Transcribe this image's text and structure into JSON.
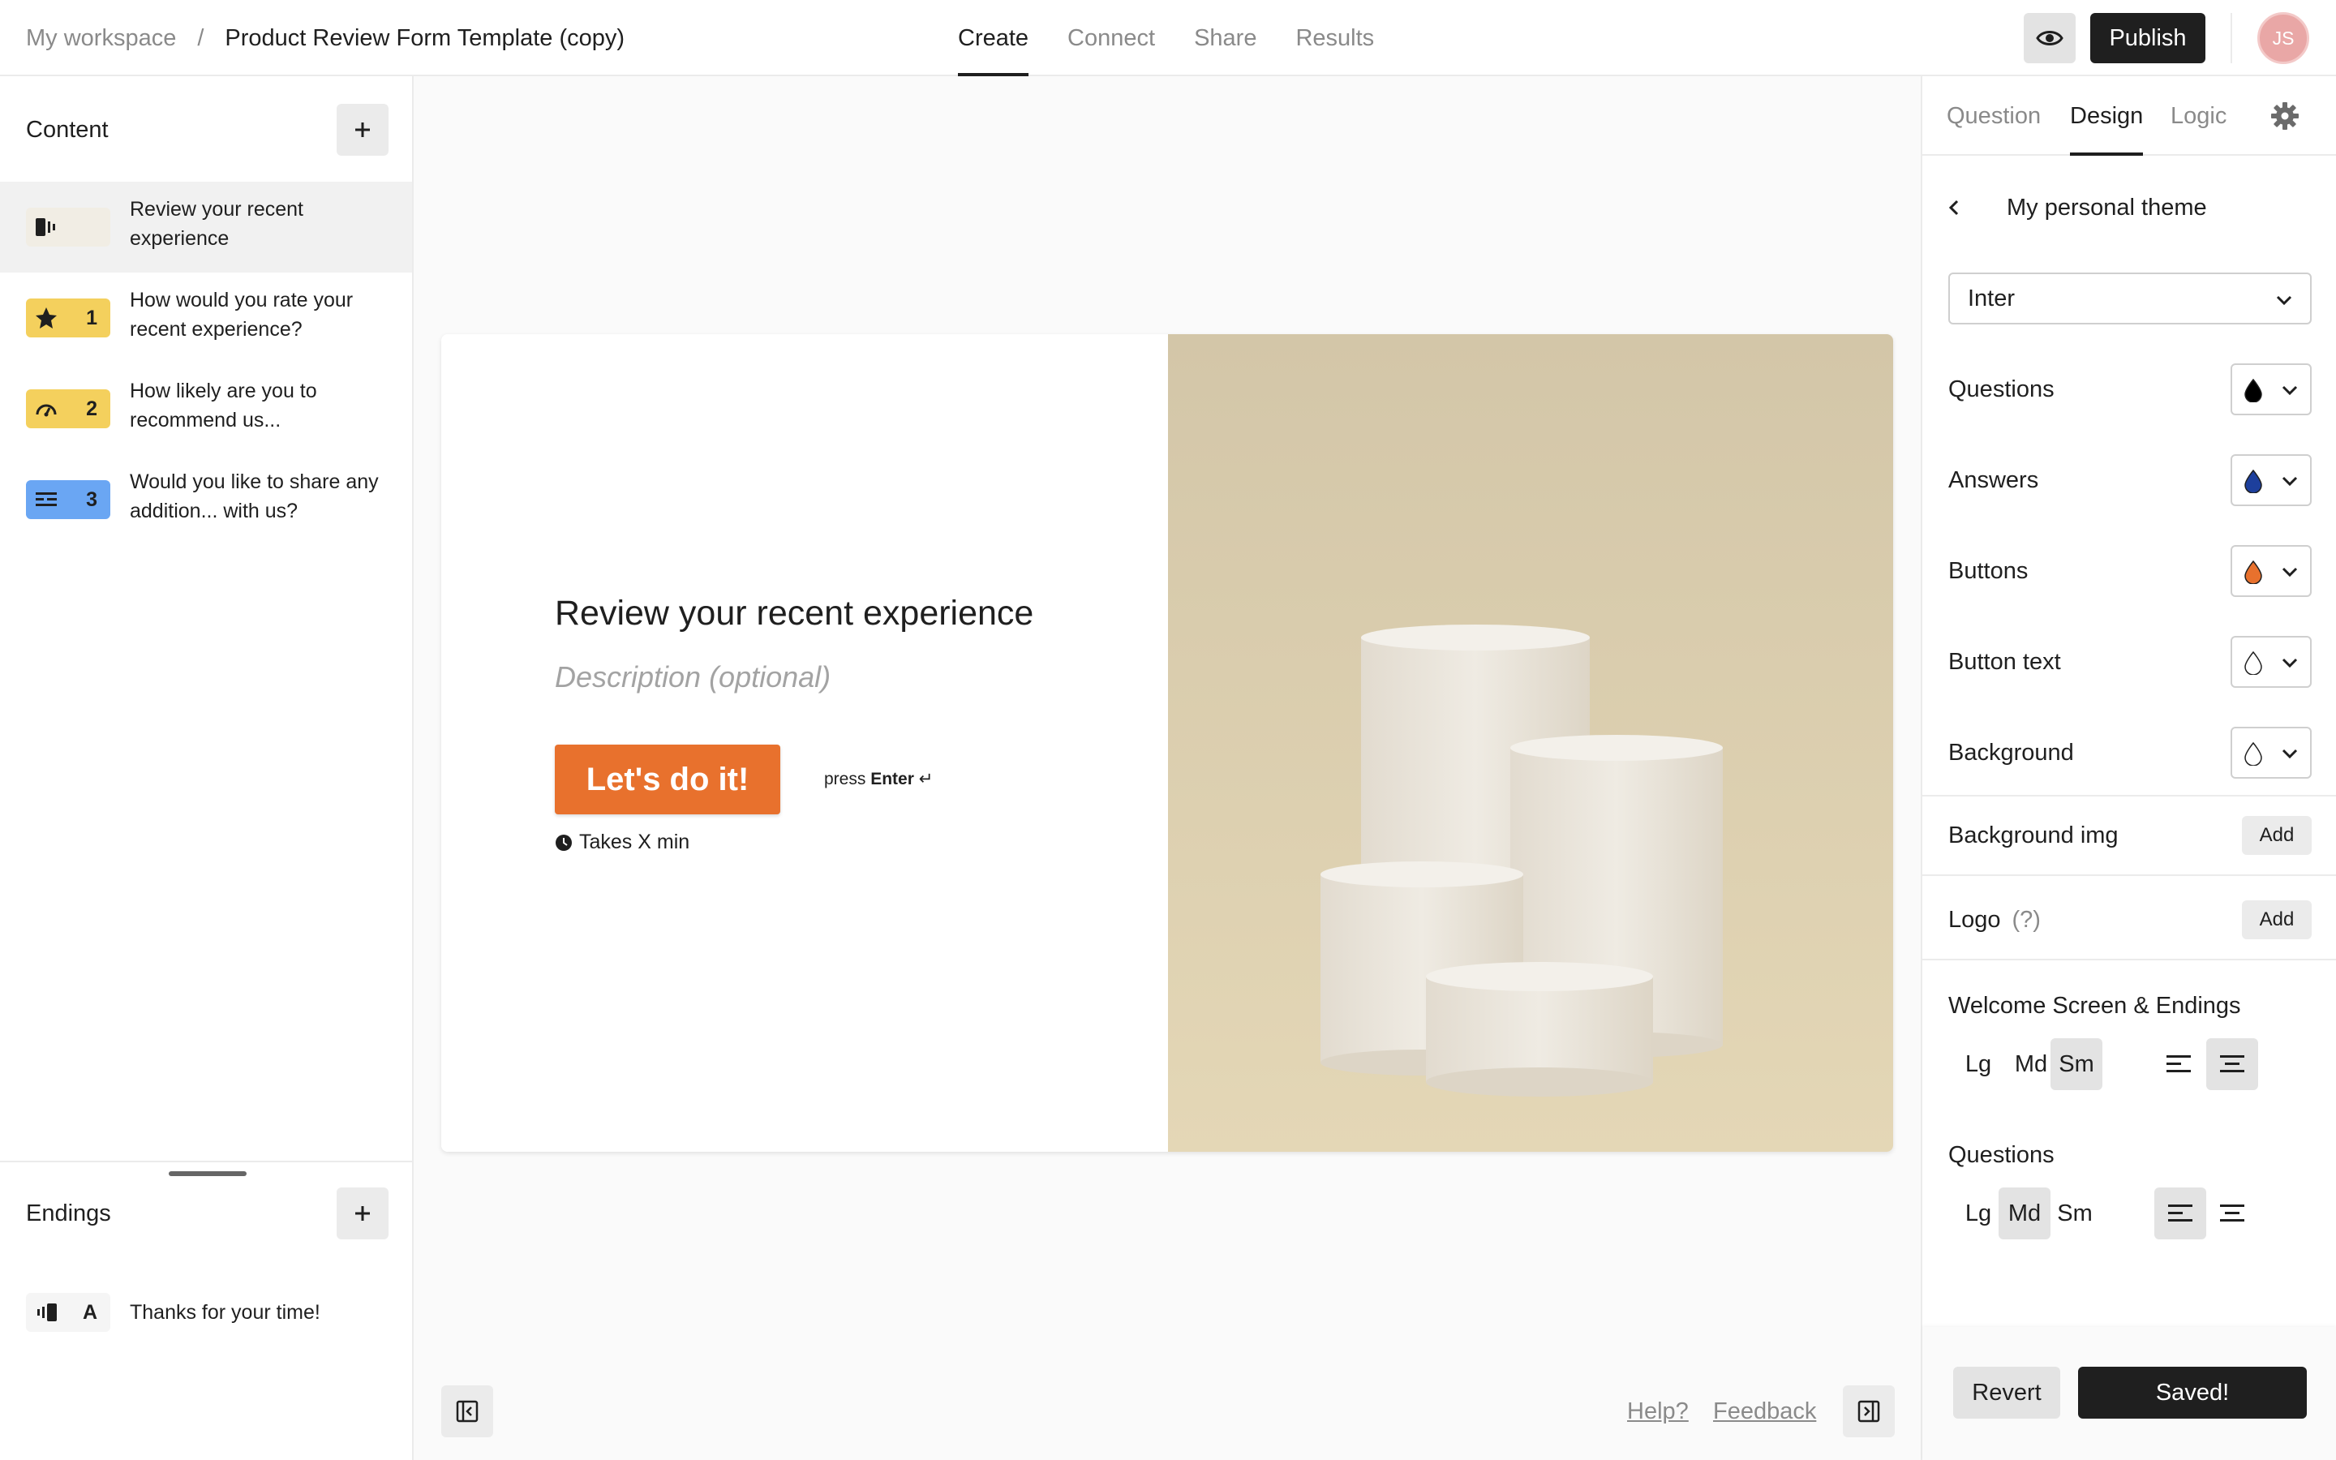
{
  "topbar": {
    "workspace": "My workspace",
    "separator": "/",
    "form_title": "Product Review Form Template (copy)",
    "tabs": [
      {
        "label": "Create",
        "active": true
      },
      {
        "label": "Connect",
        "active": false
      },
      {
        "label": "Share",
        "active": false
      },
      {
        "label": "Results",
        "active": false
      }
    ],
    "preview_icon": "eye-icon",
    "publish_label": "Publish",
    "avatar_initials": "JS"
  },
  "sidebar": {
    "content_title": "Content",
    "add_icon": "plus-icon",
    "items": [
      {
        "icon": "welcome-screen-icon",
        "number": "",
        "label": "Review your recent experience",
        "color": "#f1ede4",
        "selected": true
      },
      {
        "icon": "star-icon",
        "number": "1",
        "label": "How would you rate your recent experience?",
        "color": "#f4d05d",
        "selected": false
      },
      {
        "icon": "gauge-icon",
        "number": "2",
        "label": "How likely are you to recommend us...",
        "color": "#f4d05d",
        "selected": false
      },
      {
        "icon": "long-text-icon",
        "number": "3",
        "label": "Would you like to share any addition... with us?",
        "color": "#6aa6f3",
        "selected": false
      }
    ],
    "endings_title": "Endings",
    "endings": [
      {
        "icon": "ending-screen-icon",
        "letter": "A",
        "label": "Thanks for your time!",
        "color": "#f5f5f5"
      }
    ]
  },
  "canvas": {
    "welcome_title": "Review your recent experience",
    "description_placeholder": "Description (optional)",
    "button_label": "Let's do it!",
    "press_text": "press",
    "enter_text": "Enter",
    "enter_symbol": "↵",
    "time_text": "Takes X min",
    "button_color": "#e8712d",
    "image_background": "#d8c9aa",
    "help_label": "Help?",
    "feedback_label": "Feedback"
  },
  "design_panel": {
    "tabs": [
      {
        "label": "Question",
        "active": false
      },
      {
        "label": "Design",
        "active": true
      },
      {
        "label": "Logic",
        "active": false
      }
    ],
    "settings_icon": "gear-icon",
    "theme_name": "My personal theme",
    "font": "Inter",
    "colors": [
      {
        "label": "Questions",
        "color": "#000000"
      },
      {
        "label": "Answers",
        "color": "#1d3f9c"
      },
      {
        "label": "Buttons",
        "color": "#e8712d"
      },
      {
        "label": "Button text",
        "color": "#ffffff"
      },
      {
        "label": "Background",
        "color": "#ffffff"
      }
    ],
    "background_img_label": "Background img",
    "background_img_action": "Add",
    "logo_label": "Logo",
    "logo_hint": "(?)",
    "logo_action": "Add",
    "welcome_size_label": "Welcome Screen & Endings",
    "welcome_sizes": [
      {
        "label": "Lg",
        "active": false
      },
      {
        "label": "Md",
        "active": false
      },
      {
        "label": "Sm",
        "active": true
      }
    ],
    "welcome_alignment": "center",
    "questions_size_label": "Questions",
    "question_sizes": [
      {
        "label": "Lg",
        "active": false
      },
      {
        "label": "Md",
        "active": true
      },
      {
        "label": "Sm",
        "active": false
      }
    ],
    "questions_alignment": "left",
    "revert_label": "Revert",
    "saved_label": "Saved!"
  }
}
